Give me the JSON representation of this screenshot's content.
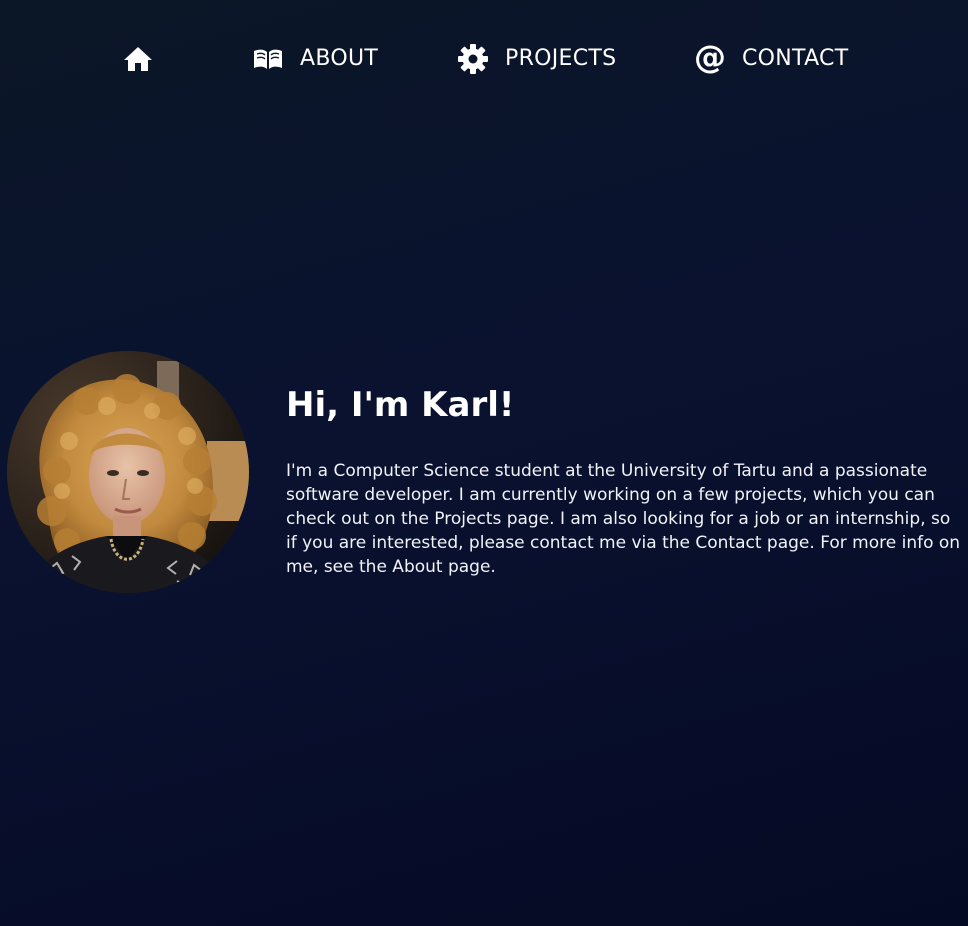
{
  "nav": {
    "home": {
      "icon": "home-icon"
    },
    "about": {
      "icon": "book-icon",
      "label": "ABOUT"
    },
    "projects": {
      "icon": "gear-icon",
      "label": "PROJECTS"
    },
    "contact": {
      "icon": "at-sign-icon",
      "label": "CONTACT",
      "glyph": "@"
    }
  },
  "hero": {
    "avatar_icon": "profile-photo",
    "title": "Hi, I'm Karl!",
    "text": "I'm a Computer Science student at the University of Tartu and a passionate software developer. I am currently working on a few projects, which you can check out on the Projects page. I am also looking for a job or an internship, so if you are interested, please contact me via the Contact page. For more info on me, see the About page."
  },
  "colors": {
    "background_top": "#0b1626",
    "background_bottom": "#050a24",
    "text": "#ffffff"
  }
}
